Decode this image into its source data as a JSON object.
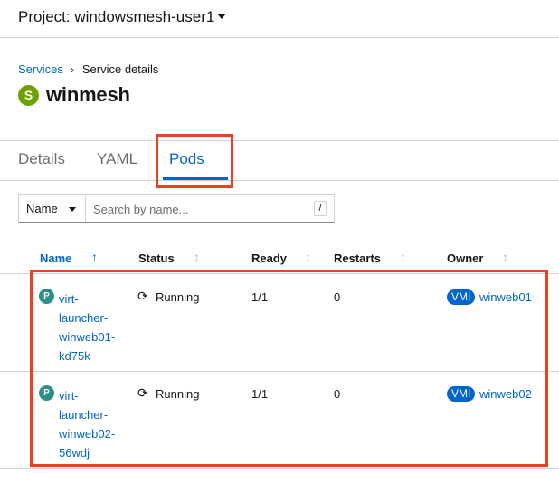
{
  "project": {
    "label": "Project: windowsmesh-user1"
  },
  "breadcrumb": {
    "parent": "Services",
    "separator": "›",
    "current": "Service details"
  },
  "resource": {
    "badge": "S",
    "name": "winmesh"
  },
  "tabs": [
    {
      "label": "Details"
    },
    {
      "label": "YAML"
    },
    {
      "label": "Pods",
      "active": true
    }
  ],
  "filter": {
    "type": "Name",
    "placeholder": "Search by name...",
    "shortcut": "/"
  },
  "table": {
    "columns": [
      {
        "label": "Name",
        "sort_icon": "↑"
      },
      {
        "label": "Status",
        "sort_icon": "↕"
      },
      {
        "label": "Ready",
        "sort_icon": "↕"
      },
      {
        "label": "Restarts",
        "sort_icon": "↕"
      },
      {
        "label": "Owner",
        "sort_icon": "↕"
      }
    ],
    "rows": [
      {
        "badge": "P",
        "name_lines": [
          "virt-",
          "launcher-",
          "winweb01-",
          "kd75k"
        ],
        "status_icon": "⟳",
        "status": "Running",
        "ready": "1/1",
        "restarts": "0",
        "owner_badge": "VMI",
        "owner": "winweb01"
      },
      {
        "badge": "P",
        "name_lines": [
          "virt-",
          "launcher-",
          "winweb02-",
          "56wdj"
        ],
        "status_icon": "⟳",
        "status": "Running",
        "ready": "1/1",
        "restarts": "0",
        "owner_badge": "VMI",
        "owner": "winweb02"
      }
    ]
  },
  "colors": {
    "link": "#0066cc",
    "highlight": "#e8411f",
    "service_badge": "#6ca100",
    "pod_badge": "#2e8c8a"
  }
}
